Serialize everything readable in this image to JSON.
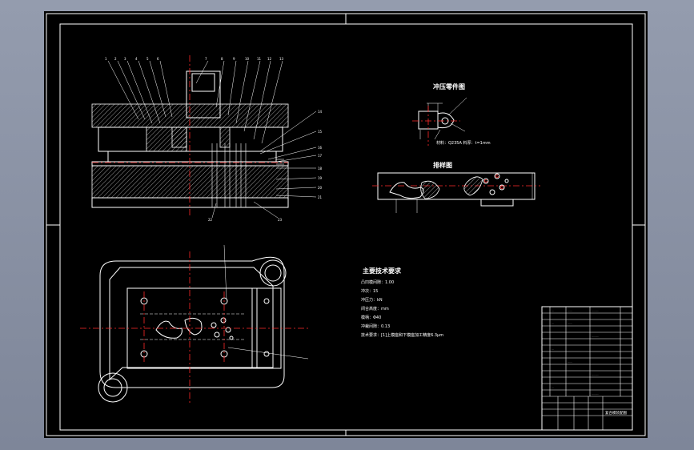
{
  "drawing": {
    "colors": {
      "background": "#000000",
      "lines": "#ffffff",
      "centerlines": "#ff2a2a",
      "viewport": "#8a93a5"
    },
    "labels": {
      "part_view": "冲压零件图",
      "part_material": "材料：Q235A  料厚：t=1mm",
      "strip_view": "排样图",
      "tech_title": "主要技术要求",
      "tech_lines": [
        "凸凹模间隙：1.00",
        "冲次：15",
        "冲压力：kN",
        "闭合高度：mm",
        "模柄：Φ40",
        "冲裁间隙：0.13",
        "技术要求：[1]上模座和下模座加工精度6.3μm"
      ],
      "title_block_name": "复合模装配图"
    }
  }
}
